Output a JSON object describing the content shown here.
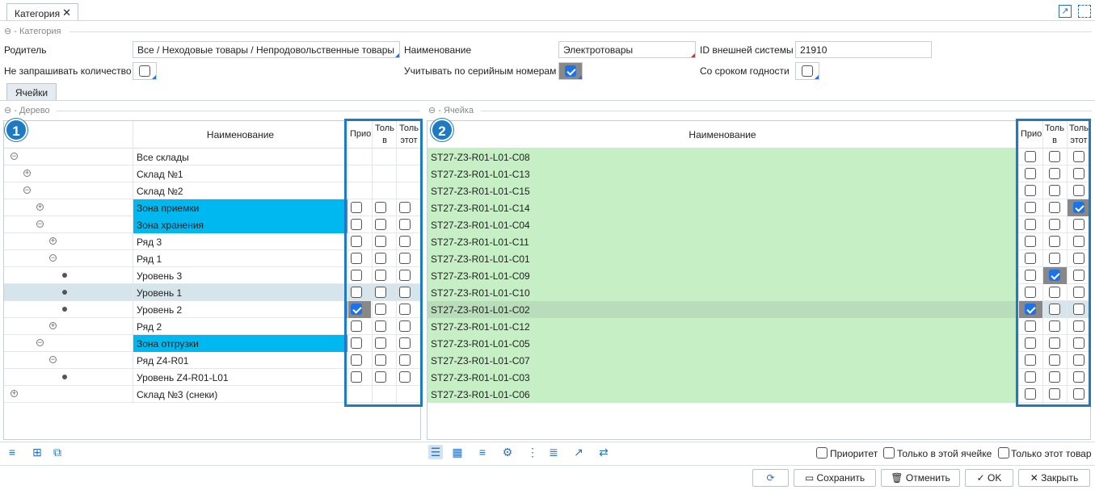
{
  "tab": {
    "label": "Категория"
  },
  "section_category": "Категория",
  "fields": {
    "parent_label": "Родитель",
    "parent_value": "Все / Неходовые товары / Непродовольственные товары",
    "name_label": "Наименование",
    "name_value": "Электротовары",
    "extid_label": "ID внешней системы",
    "extid_value": "21910",
    "noqty_label": "Не запрашивать количество",
    "noqty_checked": false,
    "serial_label": "Учитывать по серийным номерам",
    "serial_checked": true,
    "expiry_label": "Со сроком годности",
    "expiry_checked": false
  },
  "subtab": {
    "label": "Ячейки"
  },
  "tree_panel": {
    "title": "Дерево",
    "badge": "1",
    "headers": [
      "Наименование",
      "Прио",
      "Толь в",
      "Толь этот"
    ],
    "rows": [
      {
        "label": "Все склады",
        "level": 0,
        "icon": "minus",
        "checks": null,
        "hl": false
      },
      {
        "label": "Склад №1",
        "level": 1,
        "icon": "plus",
        "checks": null,
        "hl": false
      },
      {
        "label": "Склад №2",
        "level": 1,
        "icon": "minus",
        "checks": null,
        "hl": false
      },
      {
        "label": "Зона приемки",
        "level": 2,
        "icon": "plus",
        "checks": [
          false,
          false,
          false
        ],
        "hl": true
      },
      {
        "label": "Зона хранения",
        "level": 2,
        "icon": "minus",
        "checks": [
          false,
          false,
          false
        ],
        "hl": true
      },
      {
        "label": "Ряд 3",
        "level": 3,
        "icon": "plus",
        "checks": [
          false,
          false,
          false
        ],
        "hl": false
      },
      {
        "label": "Ряд 1",
        "level": 3,
        "icon": "minus",
        "checks": [
          false,
          false,
          false
        ],
        "hl": false
      },
      {
        "label": "Уровень 3",
        "level": 4,
        "icon": "dot",
        "checks": [
          false,
          false,
          false
        ],
        "hl": false
      },
      {
        "label": "Уровень 1",
        "level": 4,
        "icon": "dot",
        "checks": [
          false,
          false,
          false
        ],
        "hl": false,
        "selected": true
      },
      {
        "label": "Уровень 2",
        "level": 4,
        "icon": "dot",
        "checks": [
          true,
          false,
          false
        ],
        "hl": false
      },
      {
        "label": "Ряд 2",
        "level": 3,
        "icon": "plus",
        "checks": [
          false,
          false,
          false
        ],
        "hl": false
      },
      {
        "label": "Зона отгрузки",
        "level": 2,
        "icon": "minus",
        "checks": [
          false,
          false,
          false
        ],
        "hl": true
      },
      {
        "label": "Ряд Z4-R01",
        "level": 3,
        "icon": "minus",
        "checks": [
          false,
          false,
          false
        ],
        "hl": false
      },
      {
        "label": "Уровень Z4-R01-L01",
        "level": 4,
        "icon": "dot",
        "checks": [
          false,
          false,
          false
        ],
        "hl": false
      },
      {
        "label": "Склад №3 (снеки)",
        "level": 0,
        "icon": "plus",
        "checks": null,
        "hl": false
      }
    ]
  },
  "cell_panel": {
    "title": "Ячейка",
    "badge": "2",
    "headers": [
      "Наименование",
      "Прио",
      "Толь в",
      "Толь этот"
    ],
    "rows": [
      {
        "label": "ST27-Z3-R01-L01-C08",
        "checks": [
          false,
          false,
          false
        ]
      },
      {
        "label": "ST27-Z3-R01-L01-C13",
        "checks": [
          false,
          false,
          false
        ]
      },
      {
        "label": "ST27-Z3-R01-L01-C15",
        "checks": [
          false,
          false,
          false
        ]
      },
      {
        "label": "ST27-Z3-R01-L01-C14",
        "checks": [
          false,
          false,
          true
        ]
      },
      {
        "label": "ST27-Z3-R01-L01-C04",
        "checks": [
          false,
          false,
          false
        ]
      },
      {
        "label": "ST27-Z3-R01-L01-C11",
        "checks": [
          false,
          false,
          false
        ]
      },
      {
        "label": "ST27-Z3-R01-L01-C01",
        "checks": [
          false,
          false,
          false
        ]
      },
      {
        "label": "ST27-Z3-R01-L01-C09",
        "checks": [
          false,
          true,
          false
        ]
      },
      {
        "label": "ST27-Z3-R01-L01-C10",
        "checks": [
          false,
          false,
          false
        ]
      },
      {
        "label": "ST27-Z3-R01-L01-C02",
        "checks": [
          true,
          false,
          false
        ],
        "selected": true
      },
      {
        "label": "ST27-Z3-R01-L01-C12",
        "checks": [
          false,
          false,
          false
        ]
      },
      {
        "label": "ST27-Z3-R01-L01-C05",
        "checks": [
          false,
          false,
          false
        ]
      },
      {
        "label": "ST27-Z3-R01-L01-C07",
        "checks": [
          false,
          false,
          false
        ]
      },
      {
        "label": "ST27-Z3-R01-L01-C03",
        "checks": [
          false,
          false,
          false
        ]
      },
      {
        "label": "ST27-Z3-R01-L01-C06",
        "checks": [
          false,
          false,
          false
        ]
      }
    ]
  },
  "filters": {
    "priority": "Приоритет",
    "only_cell": "Только в этой ячейке",
    "only_item": "Только этот товар"
  },
  "buttons": {
    "refresh": "",
    "save": "Сохранить",
    "cancel": "Отменить",
    "ok": "OK",
    "close": "Закрыть"
  },
  "colors": {
    "accent": "#1e7ac3",
    "zone_hl": "#00b8f0",
    "cell_green": "#c6efc6",
    "selected_row": "#d6e5ec"
  }
}
